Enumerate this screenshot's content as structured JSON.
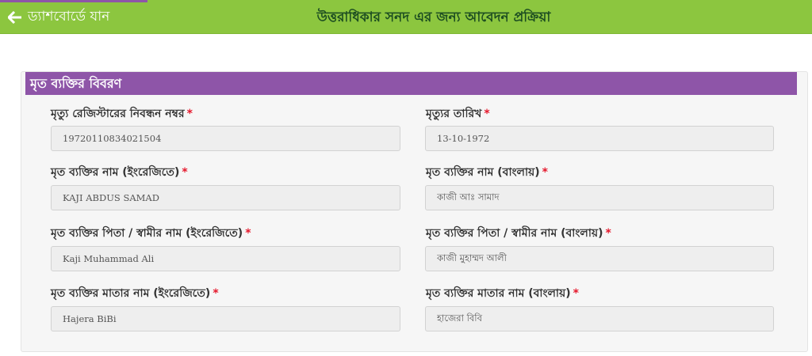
{
  "header": {
    "back_label": "ড্যাশবোর্ডে যান",
    "title": "উত্তরাধিকার সনদ এর জন্য আবেদন প্রক্রিয়া"
  },
  "panel": {
    "title": "মৃত ব্যক্তির বিবরণ"
  },
  "fields": {
    "death_reg_no": {
      "label": "মৃত্যু রেজিস্টারের নিবন্ধন নম্বর",
      "value": "19720110834021504"
    },
    "death_date": {
      "label": "মৃত্যুর তারিখ",
      "value": "13-10-1972"
    },
    "name_en": {
      "label": "মৃত ব্যক্তির নাম (ইংরেজিতে)",
      "value": "KAJI ABDUS SAMAD"
    },
    "name_bn": {
      "label": "মৃত ব্যক্তির নাম (বাংলায়)",
      "value": "কাজী আঃ সামাদ"
    },
    "father_en": {
      "label": "মৃত ব্যক্তির পিতা / স্বামীর নাম (ইংরেজিতে)",
      "value": "Kaji Muhammad Ali"
    },
    "father_bn": {
      "label": "মৃত ব্যক্তির পিতা / স্বামীর নাম (বাংলায়)",
      "value": "কাজী মুহাম্মদ আলী"
    },
    "mother_en": {
      "label": "মৃত ব্যক্তির মাতার নাম (ইংরেজিতে)",
      "value": "Hajera BiBi"
    },
    "mother_bn": {
      "label": "মৃত ব্যক্তির মাতার নাম (বাংলায়)",
      "value": "হাজেরা বিবি"
    }
  },
  "required_mark": "*",
  "icons": {
    "back": "arrow-left-icon"
  },
  "colors": {
    "header_bg": "#8cc63f",
    "panel_header_bg": "#8e55a8",
    "required": "#e5172b",
    "title_text": "#1c4d21"
  }
}
